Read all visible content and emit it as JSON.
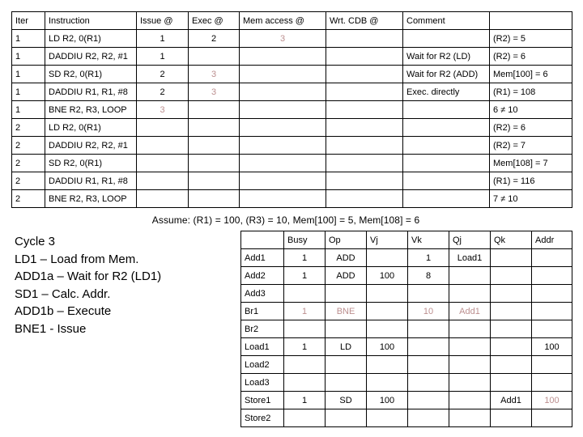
{
  "accent_rose": "#bc8f8f",
  "timing_table": {
    "headers": [
      "Iter",
      "Instruction",
      "Issue @",
      "Exec @",
      "Mem access @",
      "Wrt. CDB @",
      "Comment",
      ""
    ],
    "rows": [
      {
        "iter": "1",
        "instruction": "LD R2, 0(R1)",
        "issue": "1",
        "exec": "2",
        "mem": "3",
        "wrt": "",
        "comment": "",
        "result": "(R2) = 5",
        "styles": {
          "issue": "",
          "exec": "",
          "mem": "rose",
          "wrt": "",
          "comment": "",
          "result": ""
        }
      },
      {
        "iter": "1",
        "instruction": "DADDIU R2, R2, #1",
        "issue": "1",
        "exec": "",
        "mem": "",
        "wrt": "",
        "comment": "Wait for R2 (LD)",
        "result": "(R2) = 6",
        "styles": {
          "issue": "",
          "exec": "",
          "mem": "",
          "wrt": "",
          "comment": "",
          "result": ""
        }
      },
      {
        "iter": "1",
        "instruction": "SD R2, 0(R1)",
        "issue": "2",
        "exec": "3",
        "mem": "",
        "wrt": "",
        "comment": "Wait for R2 (ADD)",
        "result": "Mem[100] = 6",
        "styles": {
          "issue": "",
          "exec": "rose",
          "mem": "",
          "wrt": "",
          "comment": "",
          "result": ""
        }
      },
      {
        "iter": "1",
        "instruction": "DADDIU R1, R1, #8",
        "issue": "2",
        "exec": "3",
        "mem": "",
        "wrt": "",
        "comment": "Exec. directly",
        "result": "(R1) = 108",
        "styles": {
          "issue": "",
          "exec": "rose",
          "mem": "",
          "wrt": "",
          "comment": "",
          "result": ""
        }
      },
      {
        "iter": "1",
        "instruction": "BNE R2, R3, LOOP",
        "issue": "3",
        "exec": "",
        "mem": "",
        "wrt": "",
        "comment": "",
        "result": "6 ≠ 10",
        "styles": {
          "issue": "rose",
          "exec": "",
          "mem": "",
          "wrt": "",
          "comment": "",
          "result": ""
        }
      },
      {
        "iter": "2",
        "instruction": "LD R2, 0(R1)",
        "issue": "",
        "exec": "",
        "mem": "",
        "wrt": "",
        "comment": "",
        "result": "(R2) = 6",
        "styles": {
          "issue": "",
          "exec": "",
          "mem": "",
          "wrt": "",
          "comment": "",
          "result": ""
        }
      },
      {
        "iter": "2",
        "instruction": "DADDIU R2, R2, #1",
        "issue": "",
        "exec": "",
        "mem": "",
        "wrt": "",
        "comment": "",
        "result": "(R2) = 7",
        "styles": {
          "issue": "",
          "exec": "",
          "mem": "",
          "wrt": "",
          "comment": "",
          "result": ""
        }
      },
      {
        "iter": "2",
        "instruction": "SD R2, 0(R1)",
        "issue": "",
        "exec": "",
        "mem": "",
        "wrt": "",
        "comment": "",
        "result": "Mem[108] = 7",
        "styles": {
          "issue": "",
          "exec": "",
          "mem": "",
          "wrt": "",
          "comment": "",
          "result": ""
        }
      },
      {
        "iter": "2",
        "instruction": "DADDIU R1, R1, #8",
        "issue": "",
        "exec": "",
        "mem": "",
        "wrt": "",
        "comment": "",
        "result": "(R1) = 116",
        "styles": {
          "issue": "",
          "exec": "",
          "mem": "",
          "wrt": "",
          "comment": "",
          "result": ""
        }
      },
      {
        "iter": "2",
        "instruction": "BNE R2, R3, LOOP",
        "issue": "",
        "exec": "",
        "mem": "",
        "wrt": "",
        "comment": "",
        "result": "7 ≠ 10",
        "styles": {
          "issue": "",
          "exec": "",
          "mem": "",
          "wrt": "",
          "comment": "",
          "result": ""
        }
      }
    ]
  },
  "assume": {
    "text": "Assume: (R1) = 100, (R3) = 10, Mem[100] = 5, Mem[108] = 6"
  },
  "cycle_notes": {
    "lines": [
      "Cycle 3",
      "LD1 – Load from Mem.",
      "ADD1a – Wait for R2 (LD1)",
      "SD1 – Calc. Addr.",
      "ADD1b – Execute",
      "BNE1 - Issue"
    ]
  },
  "reservation_stations": {
    "headers": [
      "",
      "Busy",
      "Op",
      "Vj",
      "Vk",
      "Qj",
      "Qk",
      "Addr"
    ],
    "rows": [
      {
        "name": "Add1",
        "busy": "1",
        "op": "ADD",
        "vj": "",
        "vk": "1",
        "qj": "Load1",
        "qk": "",
        "addr": "",
        "styles": {
          "name": "",
          "busy": "",
          "op": "",
          "vj": "",
          "vk": "",
          "qj": "",
          "qk": "",
          "addr": ""
        }
      },
      {
        "name": "Add2",
        "busy": "1",
        "op": "ADD",
        "vj": "100",
        "vk": "8",
        "qj": "",
        "qk": "",
        "addr": "",
        "styles": {
          "name": "",
          "busy": "",
          "op": "",
          "vj": "",
          "vk": "",
          "qj": "",
          "qk": "",
          "addr": ""
        }
      },
      {
        "name": "Add3",
        "busy": "",
        "op": "",
        "vj": "",
        "vk": "",
        "qj": "",
        "qk": "",
        "addr": "",
        "styles": {
          "name": "",
          "busy": "",
          "op": "",
          "vj": "",
          "vk": "",
          "qj": "",
          "qk": "",
          "addr": ""
        }
      },
      {
        "name": "Br1",
        "busy": "1",
        "op": "BNE",
        "vj": "",
        "vk": "10",
        "qj": "Add1",
        "qk": "",
        "addr": "",
        "styles": {
          "name": "",
          "busy": "rose",
          "op": "rose",
          "vj": "rose",
          "vk": "rose",
          "qj": "rose",
          "qk": "rose",
          "addr": "rose"
        }
      },
      {
        "name": "Br2",
        "busy": "",
        "op": "",
        "vj": "",
        "vk": "",
        "qj": "",
        "qk": "",
        "addr": "",
        "styles": {
          "name": "",
          "busy": "",
          "op": "",
          "vj": "",
          "vk": "",
          "qj": "",
          "qk": "",
          "addr": ""
        }
      },
      {
        "name": "Load1",
        "busy": "1",
        "op": "LD",
        "vj": "100",
        "vk": "",
        "qj": "",
        "qk": "",
        "addr": "100",
        "styles": {
          "name": "",
          "busy": "",
          "op": "",
          "vj": "",
          "vk": "",
          "qj": "",
          "qk": "",
          "addr": ""
        }
      },
      {
        "name": "Load2",
        "busy": "",
        "op": "",
        "vj": "",
        "vk": "",
        "qj": "",
        "qk": "",
        "addr": "",
        "styles": {
          "name": "",
          "busy": "",
          "op": "",
          "vj": "",
          "vk": "",
          "qj": "",
          "qk": "",
          "addr": ""
        }
      },
      {
        "name": "Load3",
        "busy": "",
        "op": "",
        "vj": "",
        "vk": "",
        "qj": "",
        "qk": "",
        "addr": "",
        "styles": {
          "name": "",
          "busy": "",
          "op": "",
          "vj": "",
          "vk": "",
          "qj": "",
          "qk": "",
          "addr": ""
        }
      },
      {
        "name": "Store1",
        "busy": "1",
        "op": "SD",
        "vj": "100",
        "vk": "",
        "qj": "",
        "qk": "Add1",
        "addr": "100",
        "styles": {
          "name": "",
          "busy": "",
          "op": "",
          "vj": "",
          "vk": "",
          "qj": "",
          "qk": "",
          "addr": "rose"
        }
      },
      {
        "name": "Store2",
        "busy": "",
        "op": "",
        "vj": "",
        "vk": "",
        "qj": "",
        "qk": "",
        "addr": "",
        "styles": {
          "name": "",
          "busy": "",
          "op": "",
          "vj": "",
          "vk": "",
          "qj": "",
          "qk": "",
          "addr": ""
        }
      }
    ]
  }
}
